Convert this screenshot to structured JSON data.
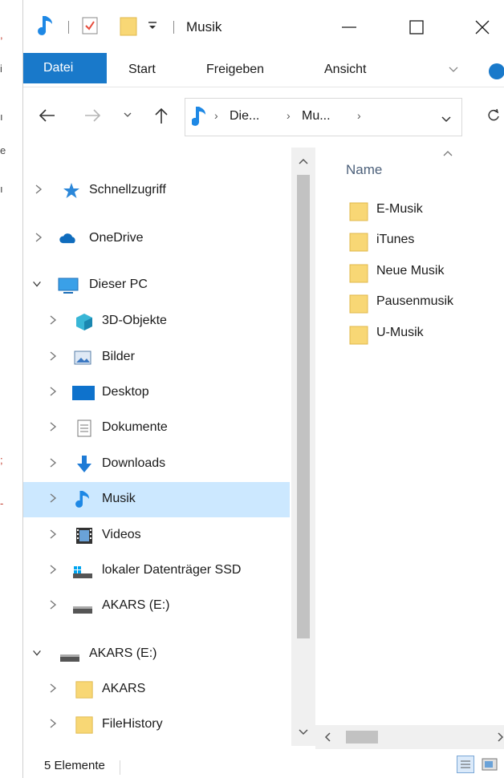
{
  "window": {
    "title": "Musik"
  },
  "ribbon": {
    "tabs": [
      {
        "label": "Datei",
        "active": true
      },
      {
        "label": "Start",
        "active": false
      },
      {
        "label": "Freigeben",
        "active": false
      },
      {
        "label": "Ansicht",
        "active": false
      }
    ]
  },
  "address": {
    "crumbs": [
      "Die...",
      "Mu..."
    ]
  },
  "nav": {
    "items": [
      {
        "label": "Schnellzugriff",
        "icon": "star-icon",
        "expanded": false
      },
      {
        "label": "OneDrive",
        "icon": "cloud-icon",
        "expanded": false
      },
      {
        "label": "Dieser PC",
        "icon": "pc-icon",
        "expanded": true
      },
      {
        "label": "3D-Objekte",
        "icon": "cube-3d-icon",
        "expanded": false
      },
      {
        "label": "Bilder",
        "icon": "pictures-icon",
        "expanded": false
      },
      {
        "label": "Desktop",
        "icon": "desktop-icon",
        "expanded": false
      },
      {
        "label": "Dokumente",
        "icon": "documents-icon",
        "expanded": false
      },
      {
        "label": "Downloads",
        "icon": "download-icon",
        "expanded": false
      },
      {
        "label": "Musik",
        "icon": "music-icon",
        "expanded": false,
        "selected": true
      },
      {
        "label": "Videos",
        "icon": "video-icon",
        "expanded": false
      },
      {
        "label": "lokaler Datenträger SSD",
        "icon": "local-disk-icon",
        "expanded": false
      },
      {
        "label": "AKARS (E:)",
        "icon": "drive-icon",
        "expanded": false
      },
      {
        "label": "AKARS (E:)",
        "icon": "drive-icon",
        "expanded": true
      },
      {
        "label": "AKARS",
        "icon": "folder-icon",
        "expanded": false
      },
      {
        "label": "FileHistory",
        "icon": "folder-icon",
        "expanded": false
      }
    ]
  },
  "content": {
    "column_header": "Name",
    "files": [
      {
        "name": "E-Musik"
      },
      {
        "name": "iTunes"
      },
      {
        "name": "Neue Musik"
      },
      {
        "name": "Pausenmusik"
      },
      {
        "name": "U-Musik"
      }
    ]
  },
  "status": {
    "count": "5 Elemente"
  },
  "colors": {
    "accent": "#1979ca",
    "selection": "#cce8ff",
    "folder": "#f8d775"
  }
}
